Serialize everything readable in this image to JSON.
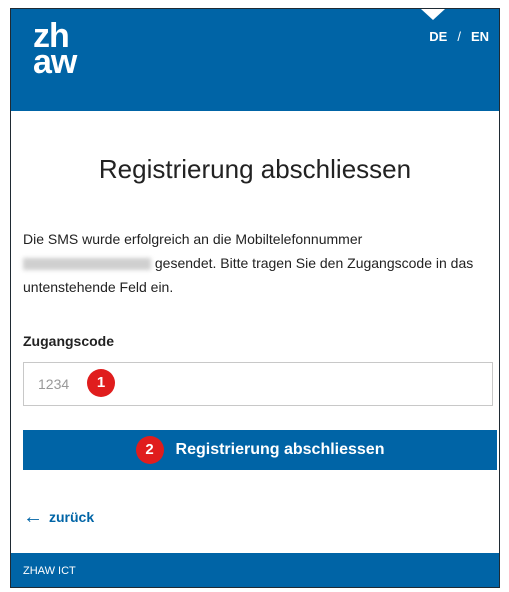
{
  "header": {
    "logo_line1": "zh",
    "logo_line2": "aw",
    "lang_de": "DE",
    "lang_sep": "/",
    "lang_en": "EN"
  },
  "main": {
    "title": "Registrierung abschliessen",
    "desc_part1": "Die SMS wurde erfolgreich an die Mobiltelefonnummer",
    "desc_part2": "gesendet. Bitte tragen Sie den Zugangscode in das untenstehende Feld ein.",
    "field_label": "Zugangscode",
    "field_placeholder": "1234",
    "badge1": "1",
    "badge2": "2",
    "submit_label": "Registrierung abschliessen",
    "back_arrow": "←",
    "back_label": "zurück"
  },
  "footer": {
    "text": "ZHAW ICT"
  },
  "colors": {
    "brand_blue": "#0064a6",
    "badge_red": "#e01d1d"
  }
}
